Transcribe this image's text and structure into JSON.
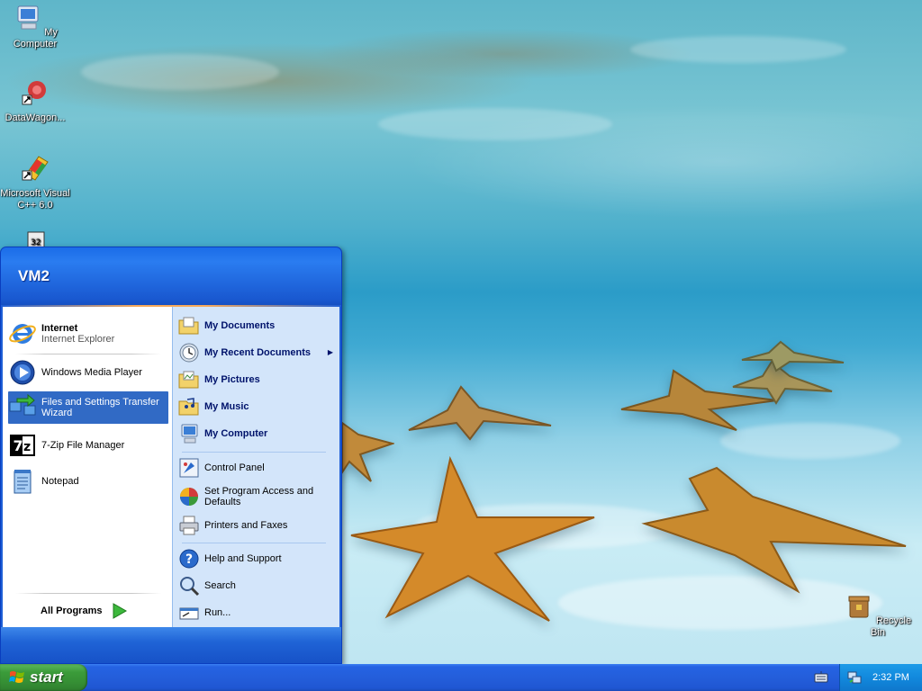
{
  "desktop": {
    "icons": [
      {
        "label": "My Computer",
        "icon": "computer-icon"
      },
      {
        "label": "DataWagon...",
        "icon": "datawagon-icon"
      },
      {
        "label": "Microsoft Visual C++ 6.0",
        "icon": "visual-cpp-icon"
      },
      {
        "label": "Recycle Bin",
        "icon": "recycle-bin-icon"
      }
    ]
  },
  "start_menu": {
    "user_name": "VM2",
    "left": {
      "pinned": [
        {
          "title": "Internet",
          "subtitle": "Internet Explorer",
          "icon": "internet-explorer-icon"
        }
      ],
      "recent": [
        {
          "label": "Windows Media Player",
          "icon": "media-player-icon"
        },
        {
          "label": "Files and Settings Transfer Wizard",
          "icon": "transfer-wizard-icon",
          "selected": true
        },
        {
          "label": "7-Zip File Manager",
          "icon": "seven-zip-icon"
        },
        {
          "label": "Notepad",
          "icon": "notepad-icon"
        }
      ],
      "all_programs": "All Programs"
    },
    "right": {
      "places": [
        {
          "label": "My Documents",
          "icon": "documents-folder-icon"
        },
        {
          "label": "My Recent Documents",
          "icon": "recent-documents-icon",
          "submenu": "▶"
        },
        {
          "label": "My Pictures",
          "icon": "pictures-folder-icon"
        },
        {
          "label": "My Music",
          "icon": "music-folder-icon"
        },
        {
          "label": "My Computer",
          "icon": "computer-icon"
        }
      ],
      "settings": [
        {
          "label": "Control Panel",
          "icon": "control-panel-icon"
        },
        {
          "label": "Set Program Access and Defaults",
          "icon": "program-defaults-icon"
        },
        {
          "label": "Printers and Faxes",
          "icon": "printer-icon"
        }
      ],
      "system": [
        {
          "label": "Help and Support",
          "icon": "help-icon"
        },
        {
          "label": "Search",
          "icon": "search-icon"
        },
        {
          "label": "Run...",
          "icon": "run-icon"
        }
      ]
    }
  },
  "taskbar": {
    "start_label": "start",
    "clock": "2:32 PM"
  },
  "colors": {
    "taskbar_blue": "#245edb",
    "start_green": "#3b9c3a",
    "selection_blue": "#316ac5",
    "right_pane": "#d3e5fa"
  }
}
